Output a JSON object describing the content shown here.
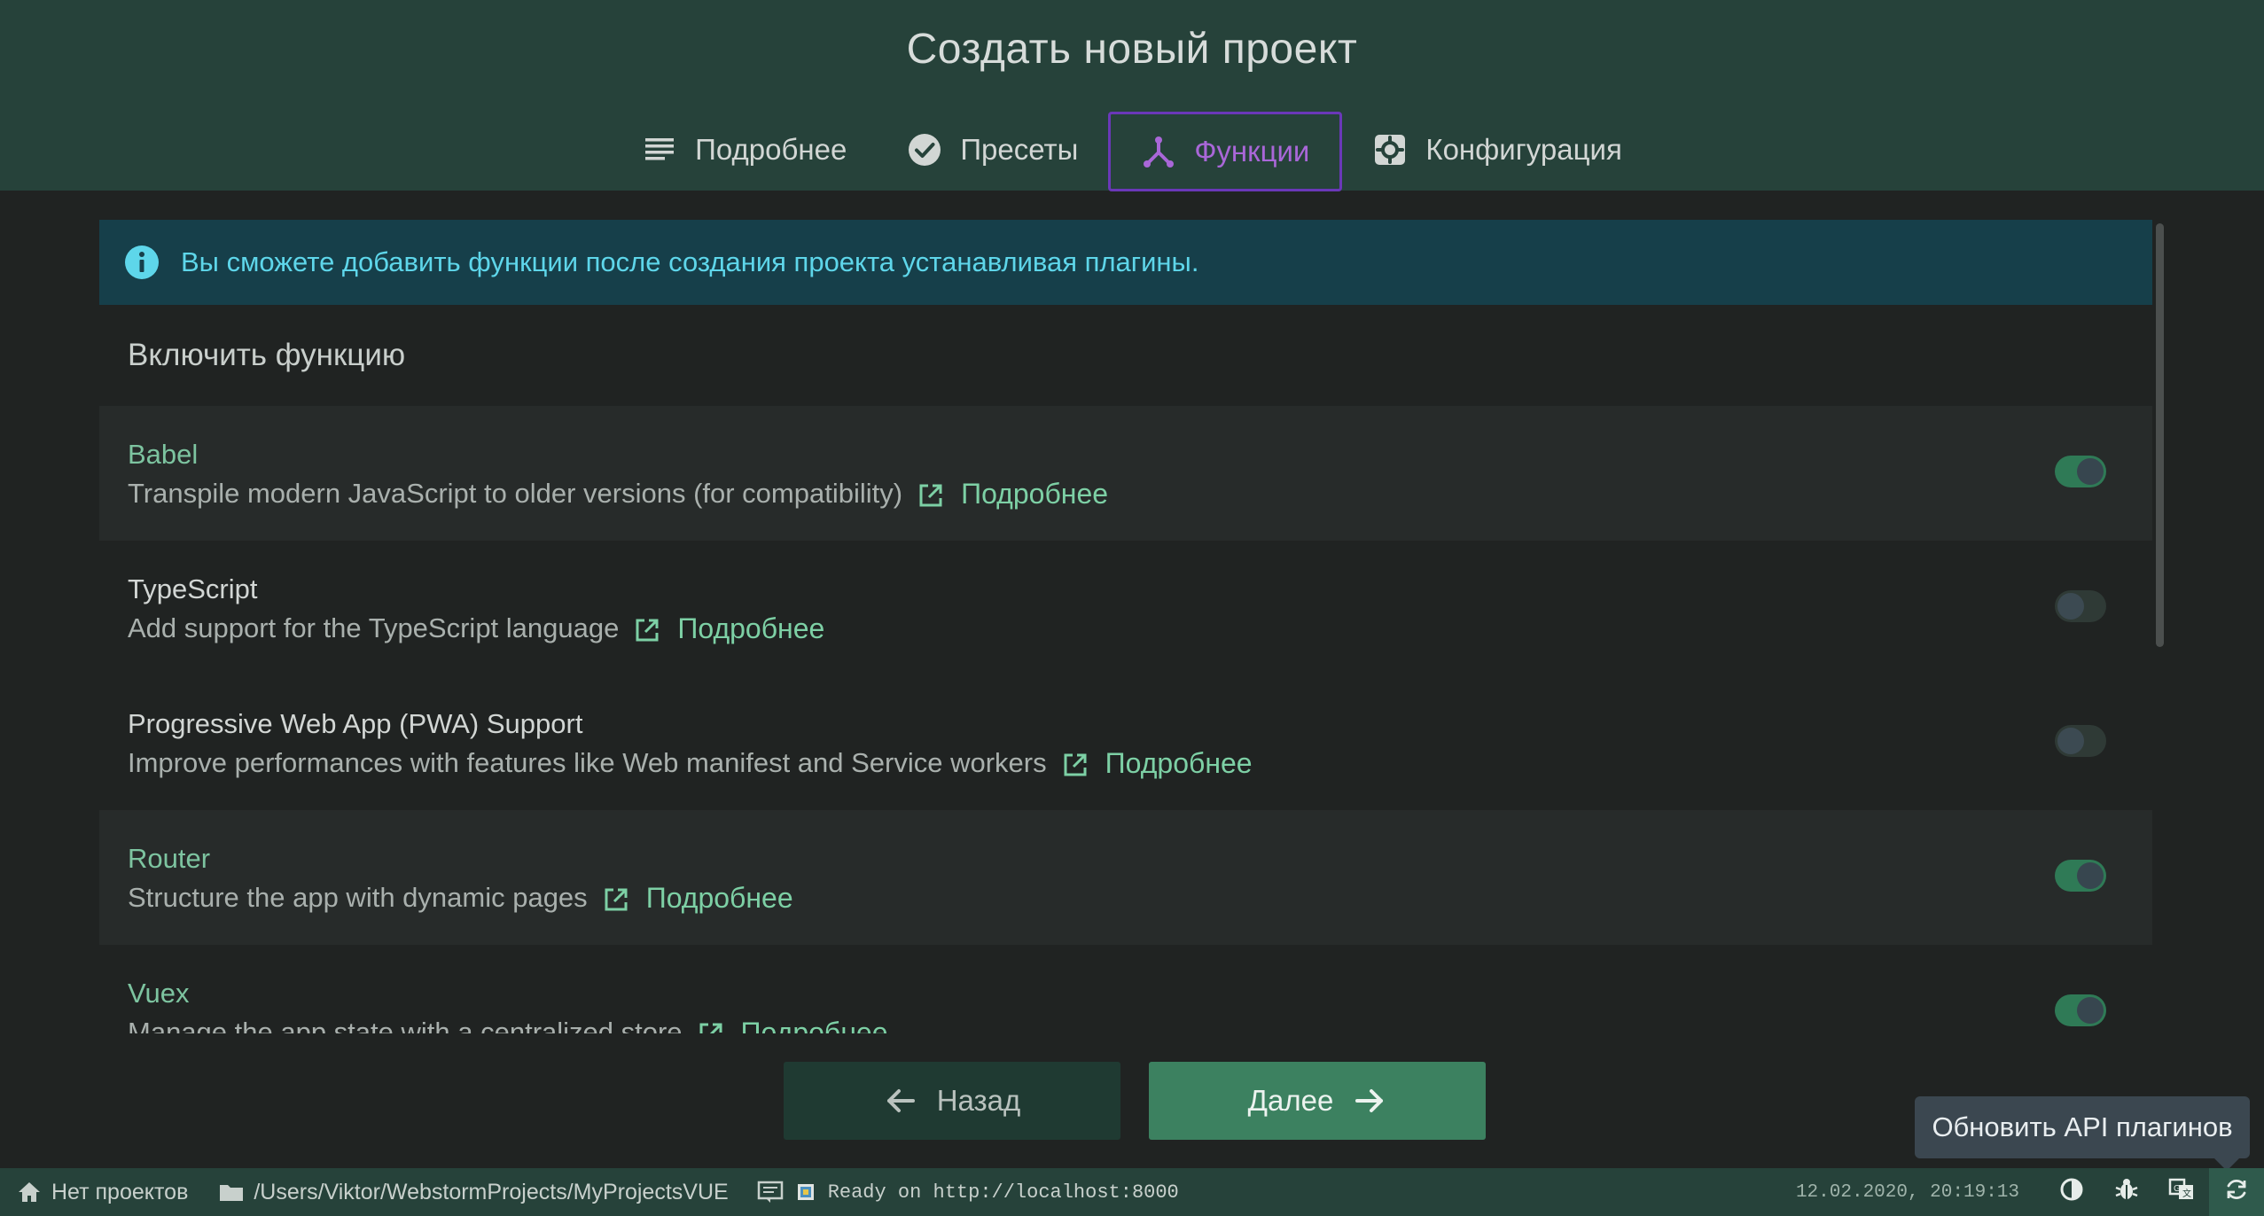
{
  "header": {
    "title": "Создать новый проект",
    "tabs": [
      {
        "label": "Подробнее",
        "icon": "list-icon",
        "active": false
      },
      {
        "label": "Пресеты",
        "icon": "check-circle-icon",
        "active": false
      },
      {
        "label": "Функции",
        "icon": "fork-icon",
        "active": true
      },
      {
        "label": "Конфигурация",
        "icon": "settings-icon",
        "active": false
      }
    ]
  },
  "info_banner": {
    "text": "Вы сможете добавить функции после создания проекта устанавливая плагины.",
    "icon": "info-icon"
  },
  "section_title": "Включить функцию",
  "features": [
    {
      "name": "Babel",
      "description": "Transpile modern JavaScript to older versions (for compatibility)",
      "link": "Подробнее",
      "enabled": true
    },
    {
      "name": "TypeScript",
      "description": "Add support for the TypeScript language",
      "link": "Подробнее",
      "enabled": false
    },
    {
      "name": "Progressive Web App (PWA) Support",
      "description": "Improve performances with features like Web manifest and Service workers",
      "link": "Подробнее",
      "enabled": false
    },
    {
      "name": "Router",
      "description": "Structure the app with dynamic pages",
      "link": "Подробнее",
      "enabled": true
    },
    {
      "name": "Vuex",
      "description": "Manage the app state with a centralized store",
      "link": "Подробнее",
      "enabled": true
    }
  ],
  "buttons": {
    "back": "Назад",
    "next": "Далее"
  },
  "tooltip": "Обновить API плагинов",
  "statusbar": {
    "projects": "Нет проектов",
    "path": "/Users/Viktor/WebstormProjects/MyProjectsVUE",
    "log": "Ready on http://localhost:8000",
    "datetime": "12.02.2020, 20:19:13"
  },
  "colors": {
    "header_bg": "#26423a",
    "accent_active_tab": "#a967d8",
    "link": "#7dd0a5",
    "info_text": "#5ed6ea",
    "primary_button": "#3c8160"
  }
}
